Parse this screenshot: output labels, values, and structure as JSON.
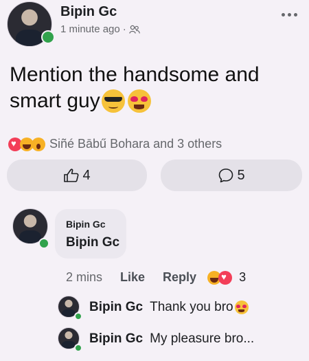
{
  "post": {
    "author": "Bipin Gc",
    "time": "1 minute ago",
    "audience_icon": "friends-icon",
    "more_icon": "more-options-icon",
    "text_line1": "Mention the handsome and",
    "text_line2": "smart guy",
    "text_emojis": [
      "smiling-face-with-sunglasses",
      "smiling-face-with-heart-eyes"
    ]
  },
  "reactions": {
    "icons": [
      "love",
      "haha",
      "wow"
    ],
    "summary": "Siñé Bābű Bohara and 3 others"
  },
  "actions": {
    "like_count": "4",
    "comment_count": "5"
  },
  "comment": {
    "tag_name": "Bipin Gc",
    "mention_name": "Bipin Gc",
    "time": "2 mins",
    "like_label": "Like",
    "reply_label": "Reply",
    "reaction_count": "3"
  },
  "replies": [
    {
      "name": "Bipin Gc",
      "text": "Thank you bro"
    },
    {
      "name": "Bipin Gc",
      "text": "My pleasure bro..."
    }
  ],
  "colors": {
    "background": "#f5f1f7",
    "online": "#31a24c",
    "button_bg": "#e4e1e8",
    "secondary_text": "#65676b"
  }
}
